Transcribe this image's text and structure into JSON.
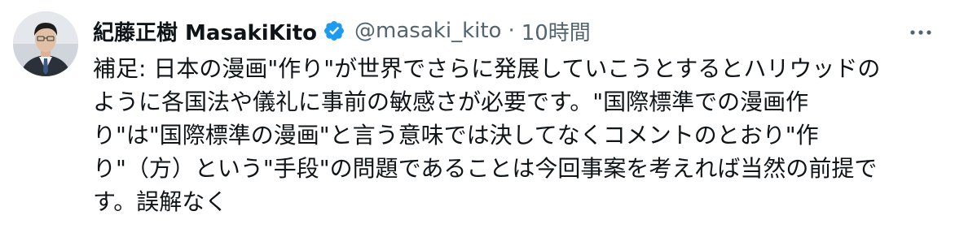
{
  "tweet": {
    "display_name": "紀藤正樹 MasakiKito",
    "handle": "@masaki_kito",
    "separator": "·",
    "time": "10時間",
    "more_label": "…",
    "verified_icon": "verified-badge-icon",
    "colors": {
      "verified": "#1d9bf0",
      "secondary_text": "#536471",
      "primary_text": "#0f1419"
    },
    "lines": [
      "補足: 日本の漫画\"作り\"が世界でさらに発展していこうとするとハリウッドの",
      "ように各国法や儀礼に事前の敏感さが必要です。\"国際標準での漫画作",
      "り\"は\"国際標準の漫画\"と言う意味では決してなくコメントのとおり\"作",
      "り\"（方）という\"手段\"の問題であることは今回事案を考えれば当然の前提で",
      "す。誤解なく"
    ]
  }
}
